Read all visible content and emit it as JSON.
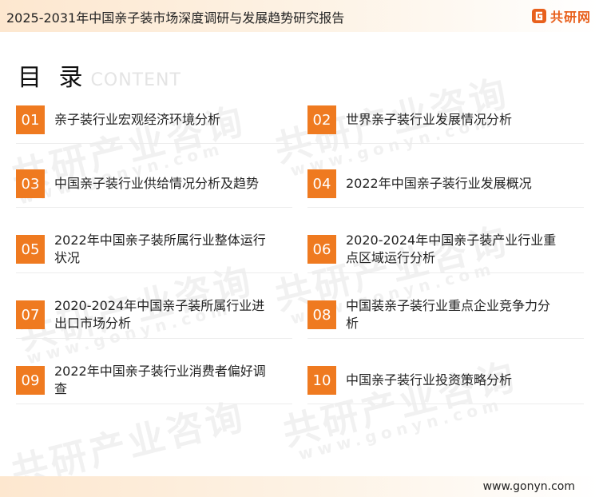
{
  "header": {
    "title": "2025-2031年中国亲子装市场深度调研与发展趋势研究报告",
    "brand": {
      "name": "共研网",
      "color": "#e8601c"
    }
  },
  "heading": {
    "title_cn": "目 录",
    "title_en": "CONTENT"
  },
  "watermark": {
    "text": "共研产业咨询",
    "url": "www.gonyn.com"
  },
  "accent_color": "#ef7a20",
  "toc": [
    {
      "num": "01",
      "label": "亲子装行业宏观经济环境分析"
    },
    {
      "num": "02",
      "label": "世界亲子装行业发展情况分析"
    },
    {
      "num": "03",
      "label": "中国亲子装行业供给情况分析及趋势"
    },
    {
      "num": "04",
      "label": "2022年中国亲子装行业发展概况"
    },
    {
      "num": "05",
      "label": "2022年中国亲子装所属行业整体运行状况"
    },
    {
      "num": "06",
      "label": "2020-2024年中国亲子装产业行业重点区域运行分析"
    },
    {
      "num": "07",
      "label": "2020-2024年中国亲子装所属行业进出口市场分析"
    },
    {
      "num": "08",
      "label": "中国装亲子装行业重点企业竞争力分析"
    },
    {
      "num": "09",
      "label": "2022年中国亲子装行业消费者偏好调查"
    },
    {
      "num": "10",
      "label": "中国亲子装行业投资策略分析"
    }
  ],
  "footer": {
    "url": "www.gonyn.com"
  }
}
